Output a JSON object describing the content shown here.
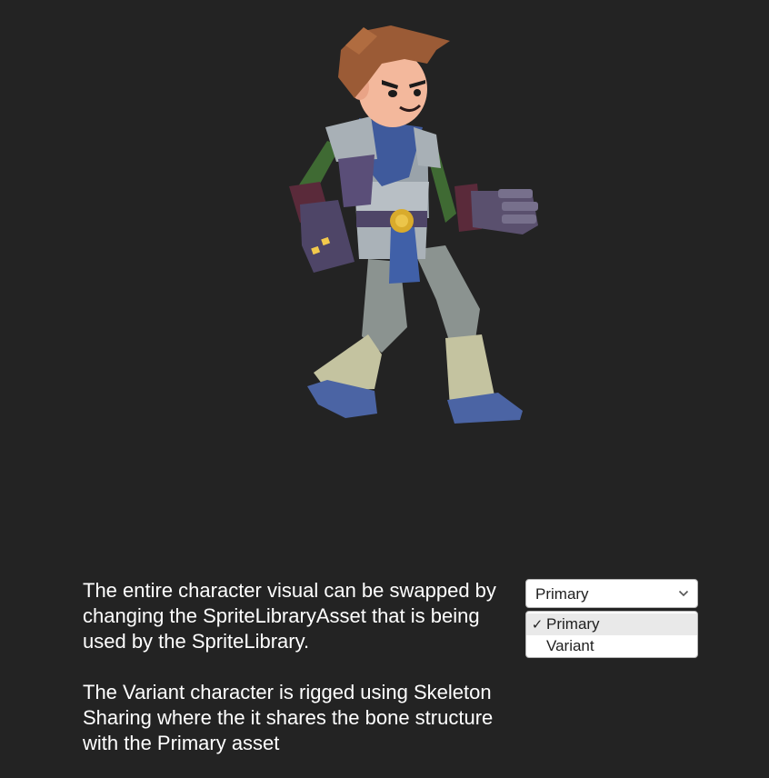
{
  "description": {
    "paragraph1": "The entire character visual can be swapped by changing the SpriteLibraryAsset that is being used by the SpriteLibrary.",
    "paragraph2": "The Variant character is rigged using Skeleton Sharing where the it shares the bone structure with the Primary asset"
  },
  "dropdown": {
    "selected": "Primary",
    "icon": "chevron-down-icon",
    "options": [
      {
        "label": "Primary",
        "checked": true,
        "check_glyph": "✓"
      },
      {
        "label": "Variant",
        "checked": false,
        "check_glyph": ""
      }
    ]
  },
  "colors": {
    "background": "#232323",
    "text": "#ffffff",
    "dropdown_bg": "#ffffff",
    "dropdown_border": "#b6b6b6",
    "menu_hover": "#e9e9e9"
  }
}
